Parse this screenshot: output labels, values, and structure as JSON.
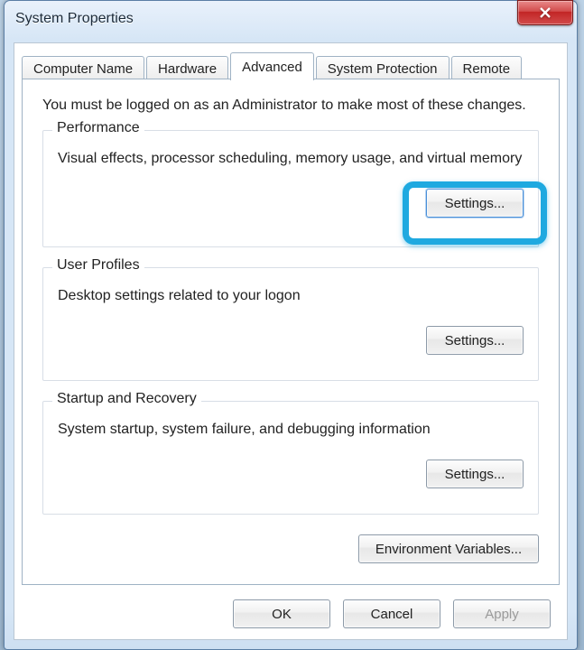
{
  "window": {
    "title": "System Properties",
    "close_icon": "close"
  },
  "tabs": {
    "computer_name": "Computer Name",
    "hardware": "Hardware",
    "advanced": "Advanced",
    "system_protection": "System Protection",
    "remote": "Remote",
    "active": "advanced"
  },
  "advanced": {
    "intro": "You must be logged on as an Administrator to make most of these changes.",
    "performance": {
      "legend": "Performance",
      "desc": "Visual effects, processor scheduling, memory usage, and virtual memory",
      "button": "Settings..."
    },
    "user_profiles": {
      "legend": "User Profiles",
      "desc": "Desktop settings related to your logon",
      "button": "Settings..."
    },
    "startup_recovery": {
      "legend": "Startup and Recovery",
      "desc": "System startup, system failure, and debugging information",
      "button": "Settings..."
    },
    "env_vars_button": "Environment Variables..."
  },
  "footer": {
    "ok": "OK",
    "cancel": "Cancel",
    "apply": "Apply"
  },
  "annotation": {
    "highlight": "performance-settings-button"
  }
}
